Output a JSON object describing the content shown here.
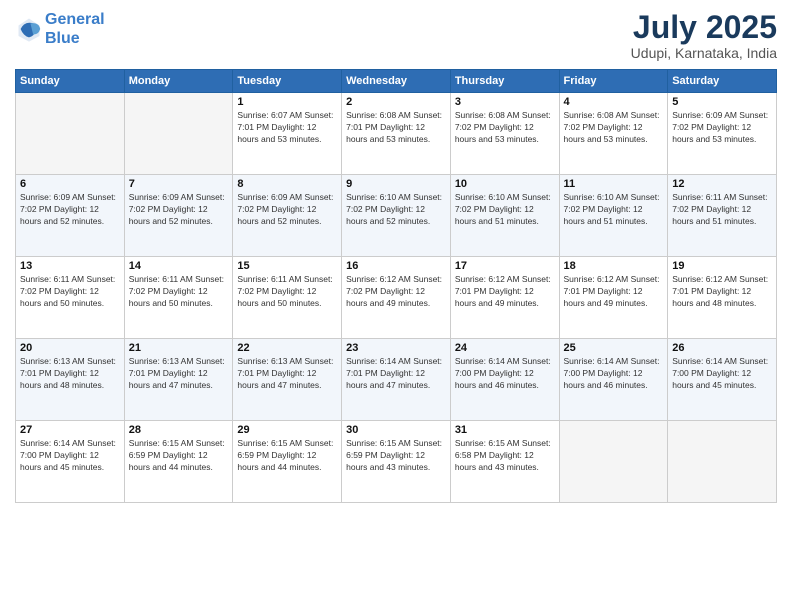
{
  "header": {
    "logo_line1": "General",
    "logo_line2": "Blue",
    "month_title": "July 2025",
    "location": "Udupi, Karnataka, India"
  },
  "days_of_week": [
    "Sunday",
    "Monday",
    "Tuesday",
    "Wednesday",
    "Thursday",
    "Friday",
    "Saturday"
  ],
  "weeks": [
    [
      {
        "day": "",
        "info": ""
      },
      {
        "day": "",
        "info": ""
      },
      {
        "day": "1",
        "info": "Sunrise: 6:07 AM\nSunset: 7:01 PM\nDaylight: 12 hours\nand 53 minutes."
      },
      {
        "day": "2",
        "info": "Sunrise: 6:08 AM\nSunset: 7:01 PM\nDaylight: 12 hours\nand 53 minutes."
      },
      {
        "day": "3",
        "info": "Sunrise: 6:08 AM\nSunset: 7:02 PM\nDaylight: 12 hours\nand 53 minutes."
      },
      {
        "day": "4",
        "info": "Sunrise: 6:08 AM\nSunset: 7:02 PM\nDaylight: 12 hours\nand 53 minutes."
      },
      {
        "day": "5",
        "info": "Sunrise: 6:09 AM\nSunset: 7:02 PM\nDaylight: 12 hours\nand 53 minutes."
      }
    ],
    [
      {
        "day": "6",
        "info": "Sunrise: 6:09 AM\nSunset: 7:02 PM\nDaylight: 12 hours\nand 52 minutes."
      },
      {
        "day": "7",
        "info": "Sunrise: 6:09 AM\nSunset: 7:02 PM\nDaylight: 12 hours\nand 52 minutes."
      },
      {
        "day": "8",
        "info": "Sunrise: 6:09 AM\nSunset: 7:02 PM\nDaylight: 12 hours\nand 52 minutes."
      },
      {
        "day": "9",
        "info": "Sunrise: 6:10 AM\nSunset: 7:02 PM\nDaylight: 12 hours\nand 52 minutes."
      },
      {
        "day": "10",
        "info": "Sunrise: 6:10 AM\nSunset: 7:02 PM\nDaylight: 12 hours\nand 51 minutes."
      },
      {
        "day": "11",
        "info": "Sunrise: 6:10 AM\nSunset: 7:02 PM\nDaylight: 12 hours\nand 51 minutes."
      },
      {
        "day": "12",
        "info": "Sunrise: 6:11 AM\nSunset: 7:02 PM\nDaylight: 12 hours\nand 51 minutes."
      }
    ],
    [
      {
        "day": "13",
        "info": "Sunrise: 6:11 AM\nSunset: 7:02 PM\nDaylight: 12 hours\nand 50 minutes."
      },
      {
        "day": "14",
        "info": "Sunrise: 6:11 AM\nSunset: 7:02 PM\nDaylight: 12 hours\nand 50 minutes."
      },
      {
        "day": "15",
        "info": "Sunrise: 6:11 AM\nSunset: 7:02 PM\nDaylight: 12 hours\nand 50 minutes."
      },
      {
        "day": "16",
        "info": "Sunrise: 6:12 AM\nSunset: 7:02 PM\nDaylight: 12 hours\nand 49 minutes."
      },
      {
        "day": "17",
        "info": "Sunrise: 6:12 AM\nSunset: 7:01 PM\nDaylight: 12 hours\nand 49 minutes."
      },
      {
        "day": "18",
        "info": "Sunrise: 6:12 AM\nSunset: 7:01 PM\nDaylight: 12 hours\nand 49 minutes."
      },
      {
        "day": "19",
        "info": "Sunrise: 6:12 AM\nSunset: 7:01 PM\nDaylight: 12 hours\nand 48 minutes."
      }
    ],
    [
      {
        "day": "20",
        "info": "Sunrise: 6:13 AM\nSunset: 7:01 PM\nDaylight: 12 hours\nand 48 minutes."
      },
      {
        "day": "21",
        "info": "Sunrise: 6:13 AM\nSunset: 7:01 PM\nDaylight: 12 hours\nand 47 minutes."
      },
      {
        "day": "22",
        "info": "Sunrise: 6:13 AM\nSunset: 7:01 PM\nDaylight: 12 hours\nand 47 minutes."
      },
      {
        "day": "23",
        "info": "Sunrise: 6:14 AM\nSunset: 7:01 PM\nDaylight: 12 hours\nand 47 minutes."
      },
      {
        "day": "24",
        "info": "Sunrise: 6:14 AM\nSunset: 7:00 PM\nDaylight: 12 hours\nand 46 minutes."
      },
      {
        "day": "25",
        "info": "Sunrise: 6:14 AM\nSunset: 7:00 PM\nDaylight: 12 hours\nand 46 minutes."
      },
      {
        "day": "26",
        "info": "Sunrise: 6:14 AM\nSunset: 7:00 PM\nDaylight: 12 hours\nand 45 minutes."
      }
    ],
    [
      {
        "day": "27",
        "info": "Sunrise: 6:14 AM\nSunset: 7:00 PM\nDaylight: 12 hours\nand 45 minutes."
      },
      {
        "day": "28",
        "info": "Sunrise: 6:15 AM\nSunset: 6:59 PM\nDaylight: 12 hours\nand 44 minutes."
      },
      {
        "day": "29",
        "info": "Sunrise: 6:15 AM\nSunset: 6:59 PM\nDaylight: 12 hours\nand 44 minutes."
      },
      {
        "day": "30",
        "info": "Sunrise: 6:15 AM\nSunset: 6:59 PM\nDaylight: 12 hours\nand 43 minutes."
      },
      {
        "day": "31",
        "info": "Sunrise: 6:15 AM\nSunset: 6:58 PM\nDaylight: 12 hours\nand 43 minutes."
      },
      {
        "day": "",
        "info": ""
      },
      {
        "day": "",
        "info": ""
      }
    ]
  ]
}
